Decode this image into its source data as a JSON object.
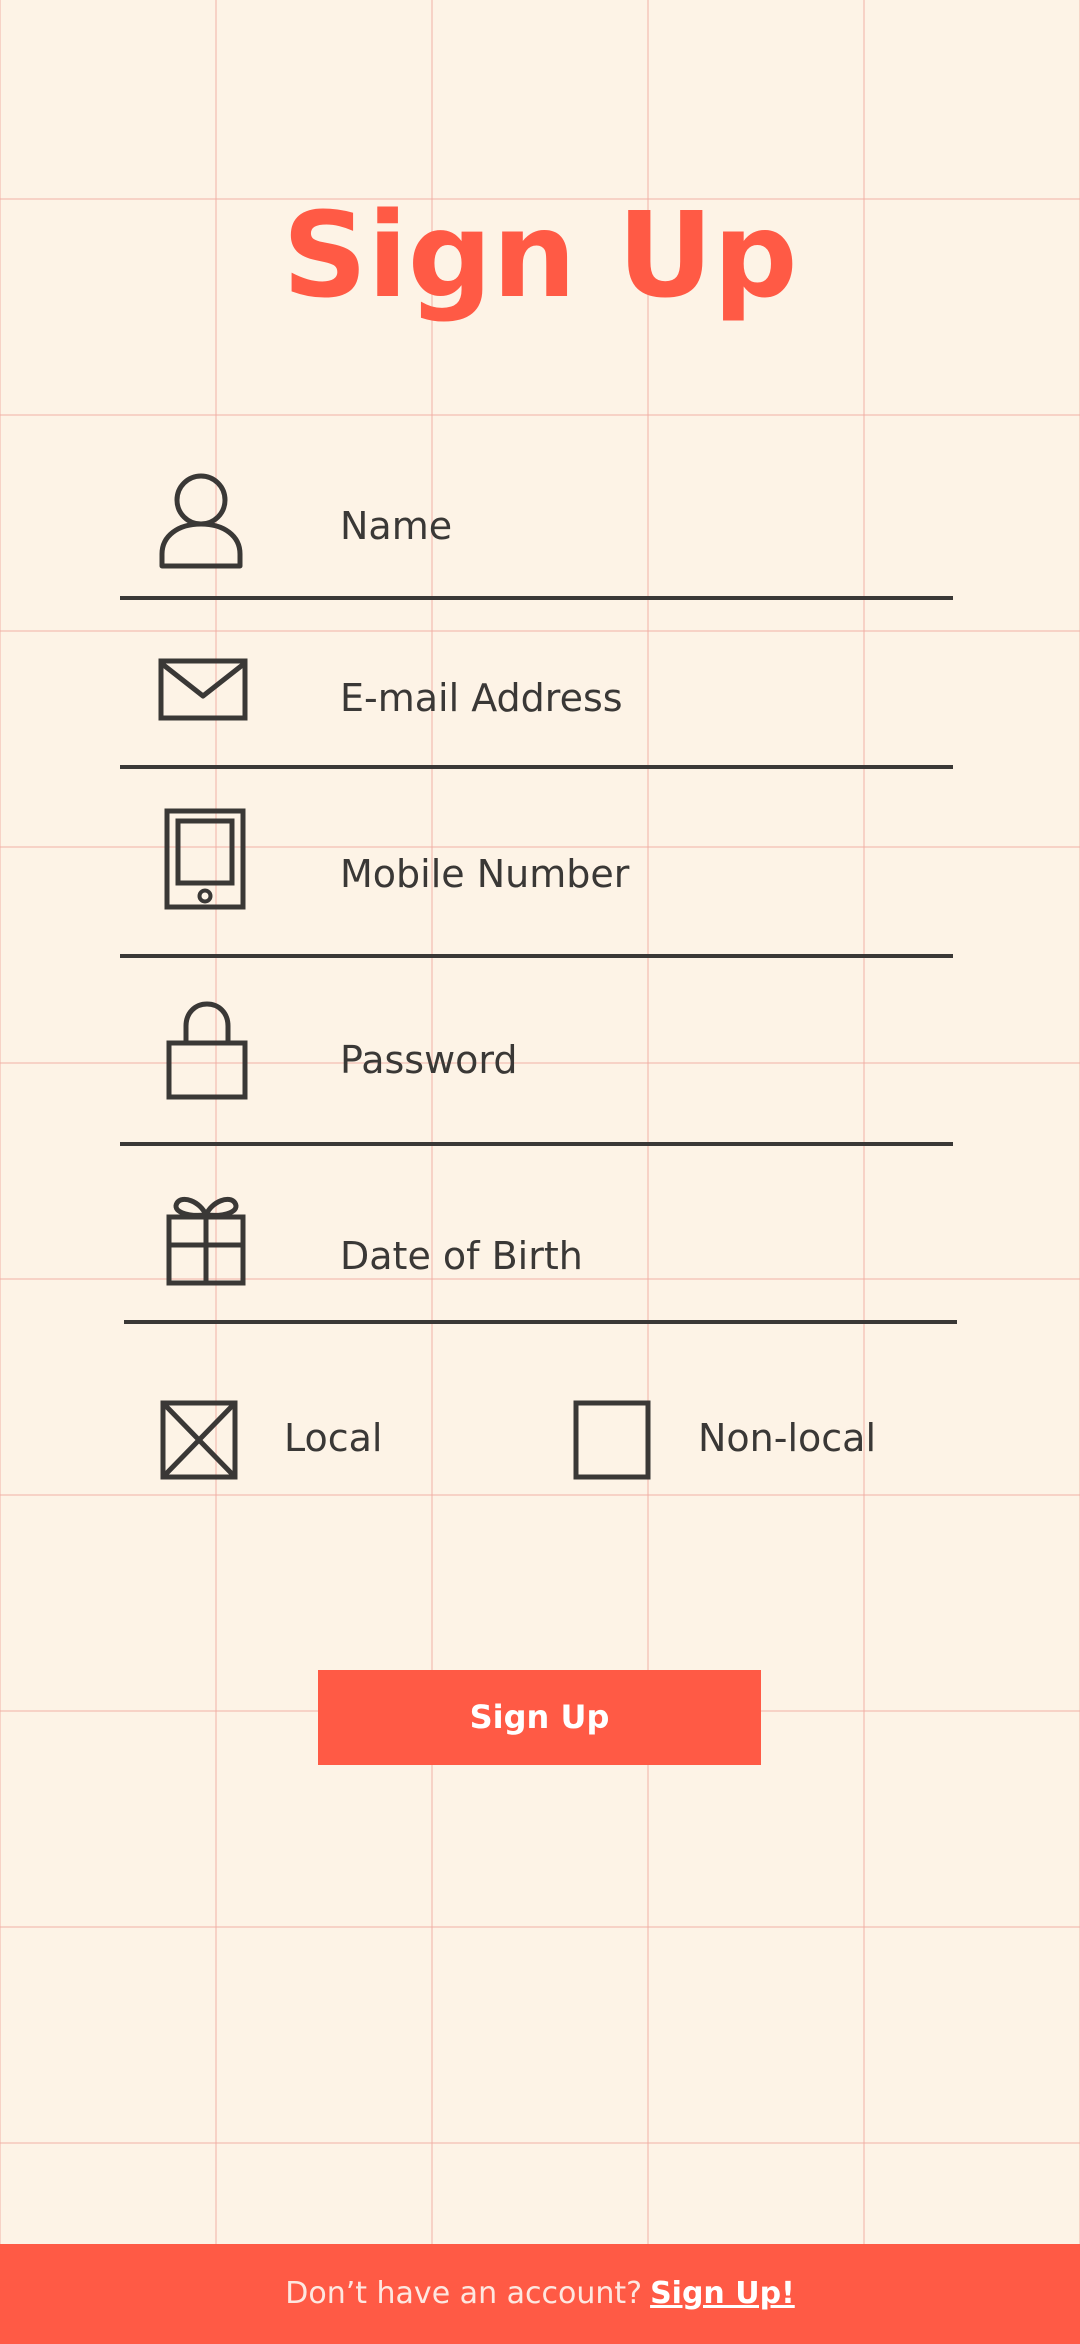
{
  "page": {
    "title": "Sign Up"
  },
  "form": {
    "fields": [
      {
        "label": "Name",
        "icon": "person-icon"
      },
      {
        "label": "E-mail Address",
        "icon": "envelope-icon"
      },
      {
        "label": "Mobile Number",
        "icon": "mobile-phone-icon"
      },
      {
        "label": "Password",
        "icon": "lock-icon"
      },
      {
        "label": "Date of Birth",
        "icon": "gift-icon"
      }
    ],
    "residency": {
      "local_label": "Local",
      "local_checked": true,
      "nonlocal_label": "Non-local",
      "nonlocal_checked": false
    },
    "submit_label": "Sign Up"
  },
  "footer": {
    "prompt": "Don’t have an account?",
    "link_label": "Sign Up!"
  },
  "colors": {
    "accent": "#ff5a45",
    "background": "#fdf3e6",
    "text": "#3a3836"
  }
}
